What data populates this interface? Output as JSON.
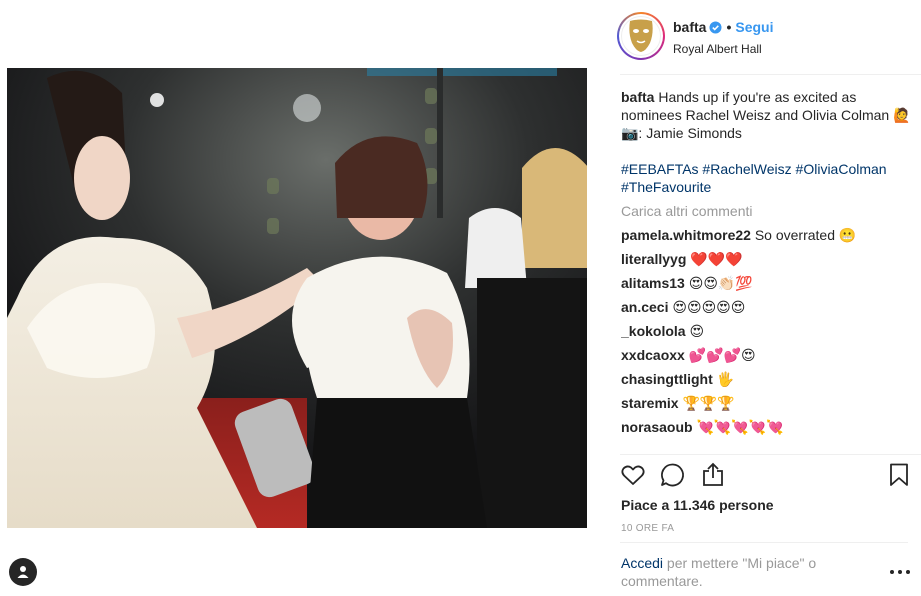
{
  "post": {
    "username": "bafta",
    "follow_label": "Segui",
    "separator": "•",
    "location": "Royal Albert Hall",
    "caption_user": "bafta",
    "caption_text": "Hands up if you're as excited as nominees Rachel Weisz and Olivia Colman 🙋",
    "caption_credit": "📷: Jamie Simonds",
    "hashtags": "#EEBAFTAs #RachelWeisz #OliviaColman #TheFavourite",
    "load_more": "Carica altri commenti",
    "comments": [
      {
        "user": "pamela.whitmore22",
        "text": "So overrated 😬"
      },
      {
        "user": "literallyyg",
        "text": "❤️❤️❤️"
      },
      {
        "user": "alitams13",
        "text": "😍😍👏🏻💯"
      },
      {
        "user": "an.ceci",
        "text": "😍😍😍😍😍"
      },
      {
        "user": "_kokolola",
        "text": "😍"
      },
      {
        "user": "xxdcaoxx",
        "text": "💕💕💕😍"
      },
      {
        "user": "chasingttlight",
        "text": "🖐"
      },
      {
        "user": "staremix",
        "text": "🏆🏆🏆"
      },
      {
        "user": "norasaoub",
        "text": "💘💘💘💘💘"
      }
    ],
    "likes_text": "Piace a 11.346 persone",
    "time_ago": "10 ORE FA",
    "login_link": "Accedi",
    "login_text": " per mettere \"Mi piace\" o commentare."
  },
  "colors": {
    "link_blue": "#3897f0",
    "hashtag_navy": "#003569",
    "muted": "#999999"
  },
  "icons": [
    "heart-icon",
    "comment-icon",
    "share-icon",
    "bookmark-icon",
    "verified-icon",
    "more-icon",
    "profile-icon"
  ]
}
